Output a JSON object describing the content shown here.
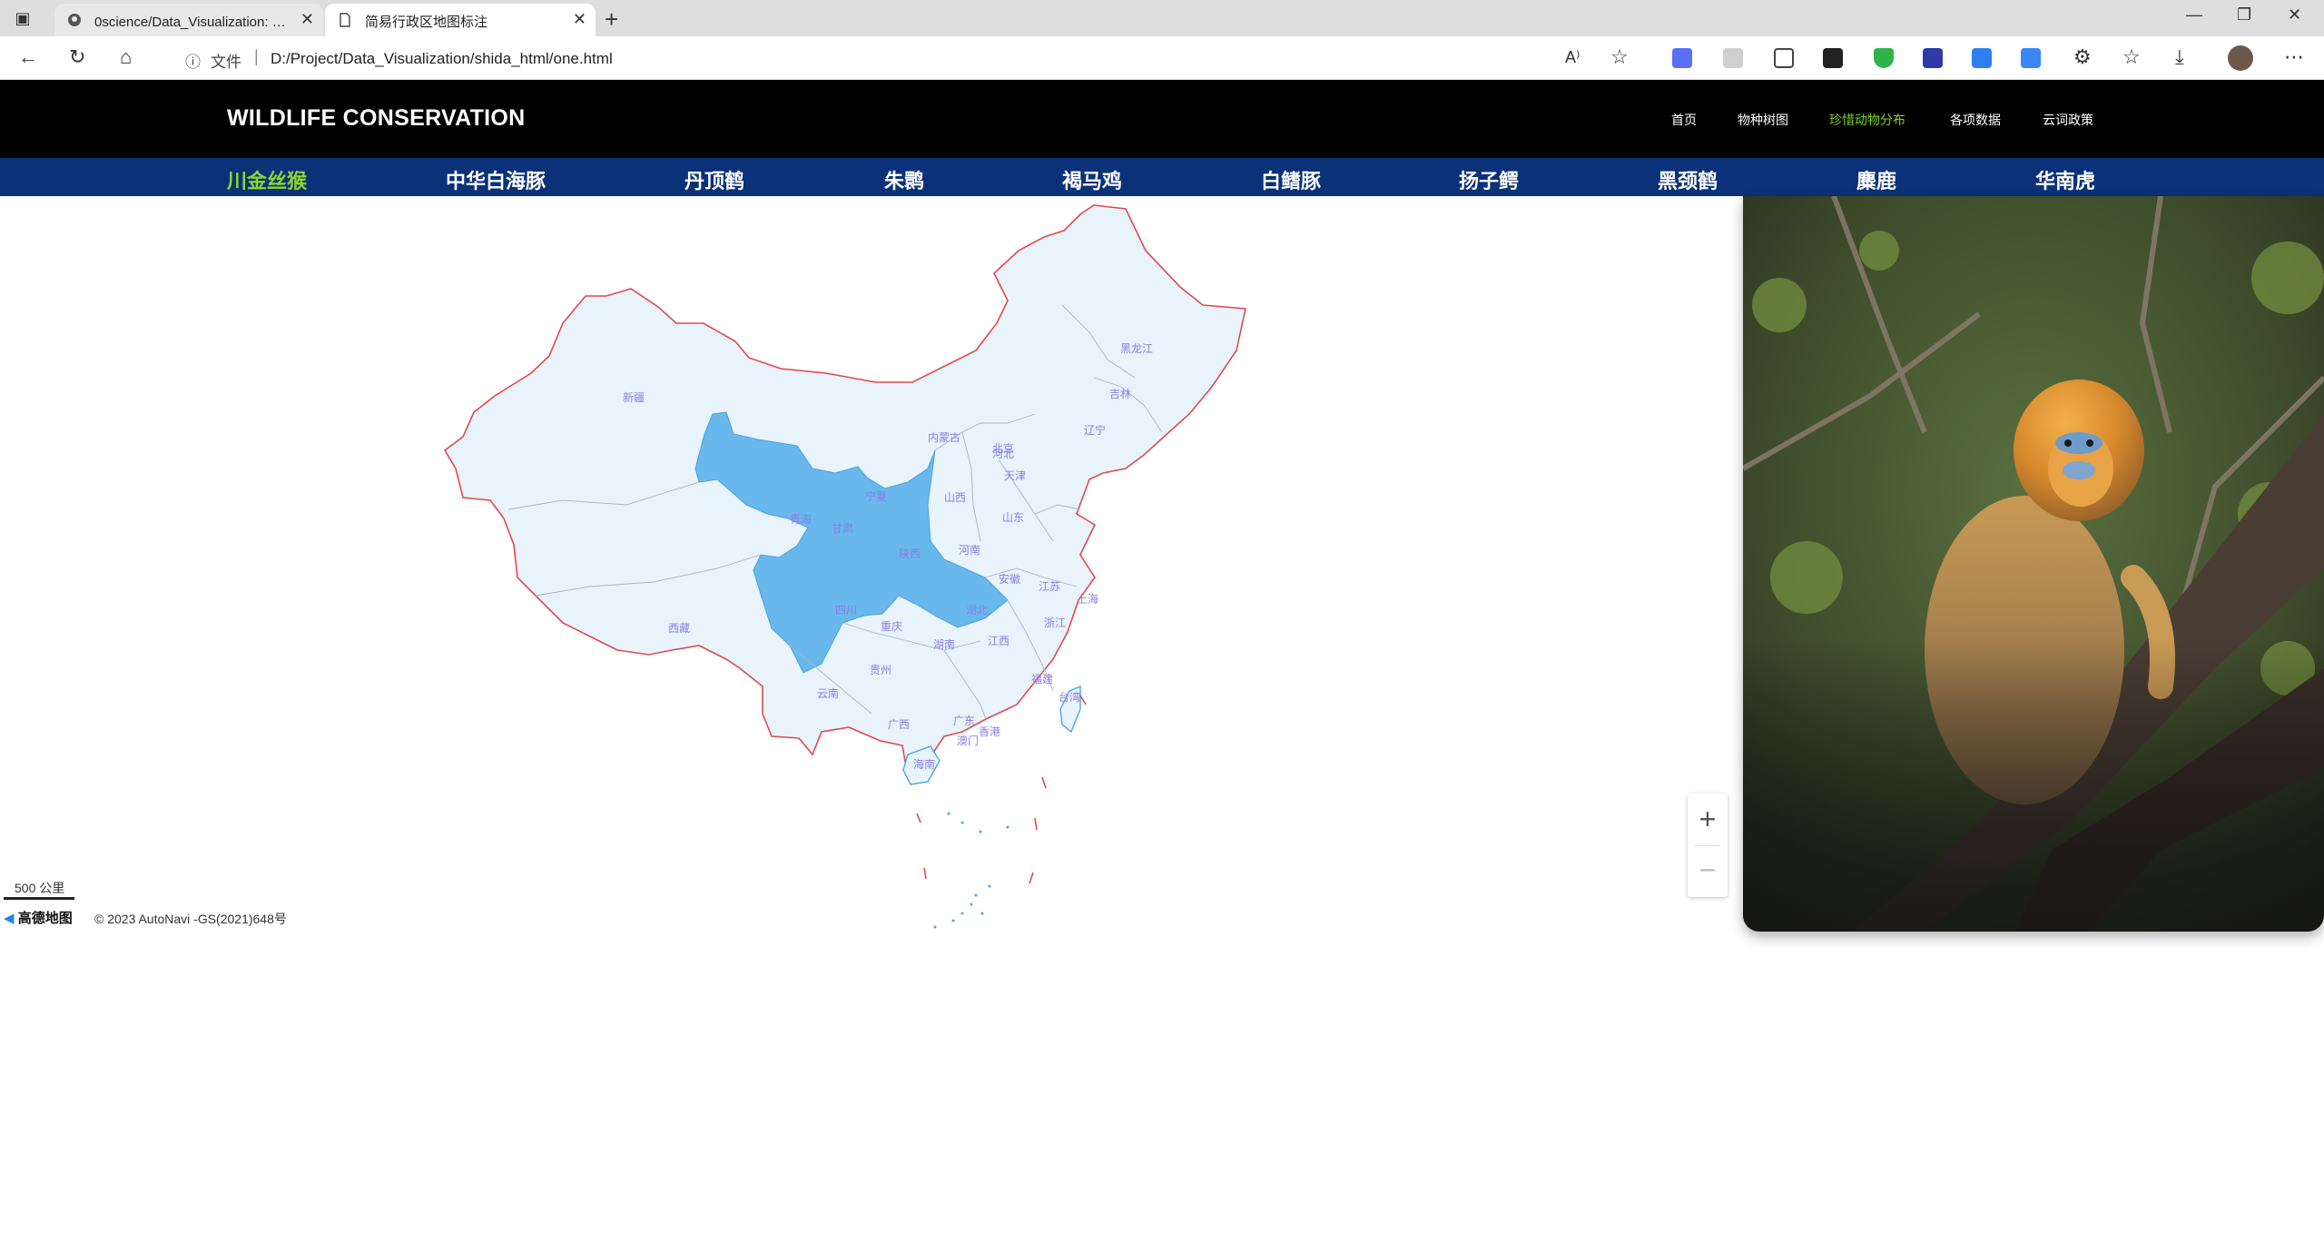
{
  "browser": {
    "tabs": [
      {
        "title": "0science/Data_Visualization: 这是",
        "icon": "github-icon",
        "active": false
      },
      {
        "title": "简易行政区地图标注",
        "icon": "page-icon",
        "active": true
      }
    ],
    "address": {
      "info_label": "文件",
      "url": "D:/Project/Data_Visualization/shida_html/one.html"
    }
  },
  "header": {
    "brand": "WILDLIFE CONSERVATION",
    "nav": [
      "首页",
      "物种树图",
      "珍惜动物分布",
      "各项数据",
      "云词政策"
    ],
    "active_nav_index": 2
  },
  "species_nav": {
    "items": [
      "川金丝猴",
      "中华白海豚",
      "丹顶鹤",
      "朱鹮",
      "褐马鸡",
      "白鳍豚",
      "扬子鳄",
      "黑颈鹤",
      "麋鹿",
      "华南虎"
    ],
    "active_index": 0
  },
  "map": {
    "provinces": [
      "新疆",
      "西藏",
      "青海",
      "甘肃",
      "宁夏",
      "内蒙古",
      "陕西",
      "四川",
      "重庆",
      "云南",
      "贵州",
      "广西",
      "广东",
      "海南",
      "湖南",
      "湖北",
      "河南",
      "山西",
      "河北",
      "北京",
      "天津",
      "山东",
      "江苏",
      "安徽",
      "浙江",
      "上海",
      "江西",
      "福建",
      "台湾",
      "黑龙江",
      "吉林",
      "辽宁",
      "香港",
      "澳门"
    ],
    "highlighted": [
      "青海",
      "甘肃",
      "陕西",
      "四川",
      "湖北"
    ],
    "colors": {
      "fill": "#e8f3fc",
      "highlight": "#68b8ee",
      "border": "#e04a4a",
      "inner": "#a8b4c4"
    },
    "scale": "500 公里",
    "logo": "高德地图",
    "copyright": "© 2023 AutoNavi -GS(2021)648号"
  },
  "photo": {
    "subject": "golden-snub-nosed-monkey"
  }
}
